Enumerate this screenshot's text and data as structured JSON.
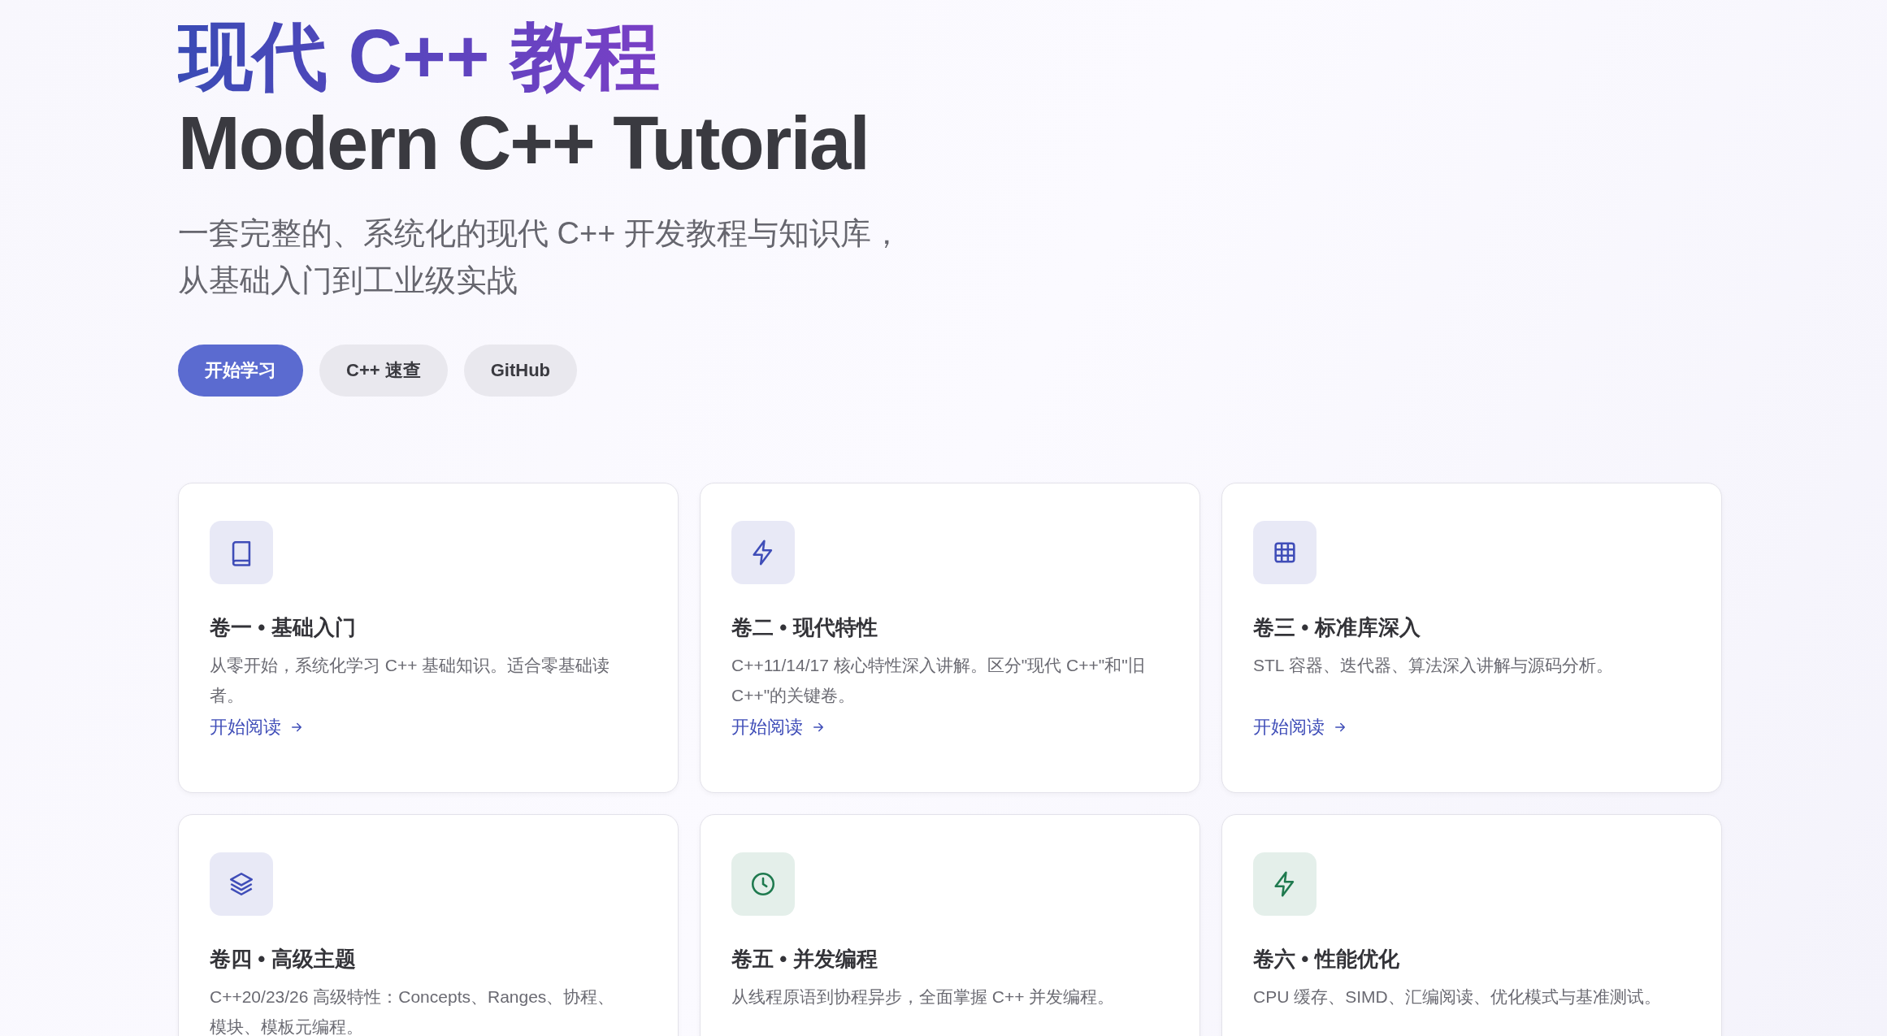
{
  "hero": {
    "title_zh": "现代 C++ 教程",
    "title_en": "Modern C++ Tutorial",
    "tagline": [
      "一套完整的、系统化的现代 C++ 开发教程与知识库，",
      "从基础入门到工业级实战"
    ],
    "buttons": [
      {
        "label": "开始学习",
        "kind": "primary"
      },
      {
        "label": "C++ 速查",
        "kind": "secondary"
      },
      {
        "label": "GitHub",
        "kind": "secondary"
      }
    ]
  },
  "cards": [
    {
      "title": "卷一 • 基础入门",
      "description": "从零开始，系统化学习 C++ 基础知识。适合零基础读者。",
      "link": "开始阅读",
      "color": "#3f4db8"
    },
    {
      "title": "卷二 • 现代特性",
      "description": "C++11/14/17 核心特性深入讲解。区分\"现代 C++\"和\"旧 C++\"的关键卷。",
      "link": "开始阅读",
      "color": "#3f4db8"
    },
    {
      "title": "卷三 • 标准库深入",
      "description": "STL 容器、迭代器、算法深入讲解与源码分析。",
      "link": "开始阅读",
      "color": "#3f4db8"
    },
    {
      "title": "卷四 • 高级主题",
      "description": "C++20/23/26 高级特性：Concepts、Ranges、协程、模块、模板元编程。",
      "color": "#3f4db8"
    },
    {
      "title": "卷五 • 并发编程",
      "description": "从线程原语到协程异步，全面掌握 C++ 并发编程。",
      "color": "#1f7a4f"
    },
    {
      "title": "卷六 • 性能优化",
      "description": "CPU 缓存、SIMD、汇编阅读、优化模式与基准测试。",
      "color": "#1f7a4f"
    }
  ]
}
